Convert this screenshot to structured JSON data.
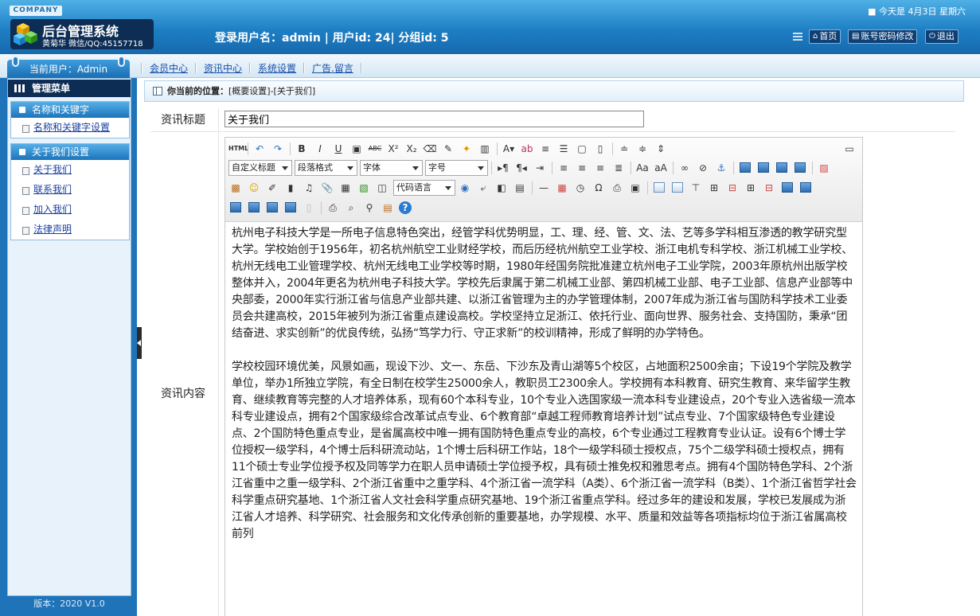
{
  "header": {
    "company": "COMPANY",
    "date_text": "■ 今天是 4月3日 星期六",
    "system_title": "后台管理系统",
    "system_sub": "黄菊华 微信/QQ:45157718",
    "login_info": "登录用户名：admin | 用户id: 24| 分组id: 5",
    "buttons": [
      "首页",
      "账号密码修改",
      "退出"
    ]
  },
  "nav": {
    "current_user": "当前用户：Admin",
    "links": [
      "会员中心",
      "资讯中心",
      "系统设置",
      "广告.留言"
    ]
  },
  "sidebar": {
    "menu_title": "管理菜单",
    "groups": [
      {
        "title": "名称和关键字",
        "items": [
          "名称和关键字设置"
        ]
      },
      {
        "title": "关于我们设置",
        "items": [
          "关于我们",
          "联系我们",
          "加入我们",
          "法律声明"
        ]
      }
    ],
    "version": "版本：2020 V1.0"
  },
  "breadcrumb": {
    "label": "你当前的位置：",
    "path": "[概要设置]-[关于我们]"
  },
  "form": {
    "title_label": "资讯标题",
    "title_value": "关于我们",
    "content_label": "资讯内容"
  },
  "editor": {
    "selects": [
      "自定义标题",
      "段落格式",
      "字体",
      "字号",
      "代码语言"
    ],
    "html_label": "HTML",
    "paragraphs": [
      "杭州电子科技大学是一所电子信息特色突出，经管学科优势明显，工、理、经、管、文、法、艺等多学科相互渗透的教学研究型大学。学校始创于1956年，初名杭州航空工业财经学校，而后历经杭州航空工业学校、浙江电机专科学校、浙江机械工业学校、杭州无线电工业管理学校、杭州无线电工业学校等时期，1980年经国务院批准建立杭州电子工业学院，2003年原杭州出版学校整体并入，2004年更名为杭州电子科技大学。学校先后隶属于第二机械工业部、第四机械工业部、电子工业部、信息产业部等中央部委，2000年实行浙江省与信息产业部共建、以浙江省管理为主的办学管理体制，2007年成为浙江省与国防科学技术工业委员会共建高校，2015年被列为浙江省重点建设高校。学校坚持立足浙江、依托行业、面向世界、服务社会、支持国防，秉承“团结奋进、求实创新”的优良传统，弘扬“笃学力行、守正求新”的校训精神，形成了鲜明的办学特色。",
      "学校校园环境优美，风景如画，现设下沙、文一、东岳、下沙东及青山湖等5个校区，占地面积2500余亩；下设19个学院及教学单位，举办1所独立学院，有全日制在校学生25000余人，教职员工2300余人。学校拥有本科教育、研究生教育、来华留学生教育、继续教育等完整的人才培养体系，现有60个本科专业，10个专业入选国家级一流本科专业建设点，20个专业入选省级一流本科专业建设点，拥有2个国家级综合改革试点专业、6个教育部“卓越工程师教育培养计划”试点专业、7个国家级特色专业建设点、2个国防特色重点专业，是省属高校中唯一拥有国防特色重点专业的高校，6个专业通过工程教育专业认证。设有6个博士学位授权一级学科，4个博士后科研流动站，1个博士后科研工作站，18个一级学科硕士授权点，75个二级学科硕士授权点，拥有11个硕士专业学位授予权及同等学力在职人员申请硕士学位授予权，具有硕士推免权和雅思考点。拥有4个国防特色学科、2个浙江省重中之重一级学科、2个浙江省重中之重学科、4个浙江省一流学科（A类）、6个浙江省一流学科（B类）、1个浙江省哲学社会科学重点研究基地、1个浙江省人文社会科学重点研究基地、19个浙江省重点学科。经过多年的建设和发展，学校已发展成为浙江省人才培养、科学研究、社会服务和文化传承创新的重要基地，办学规模、水平、质量和效益等各项指标均位于浙江省属高校前列"
    ]
  },
  "colors": {
    "header_blue": "#1e7fc4",
    "sidebar_blue": "#1f73b9",
    "link_blue": "#1a4fa8",
    "dark_navy": "#0d2d55"
  }
}
